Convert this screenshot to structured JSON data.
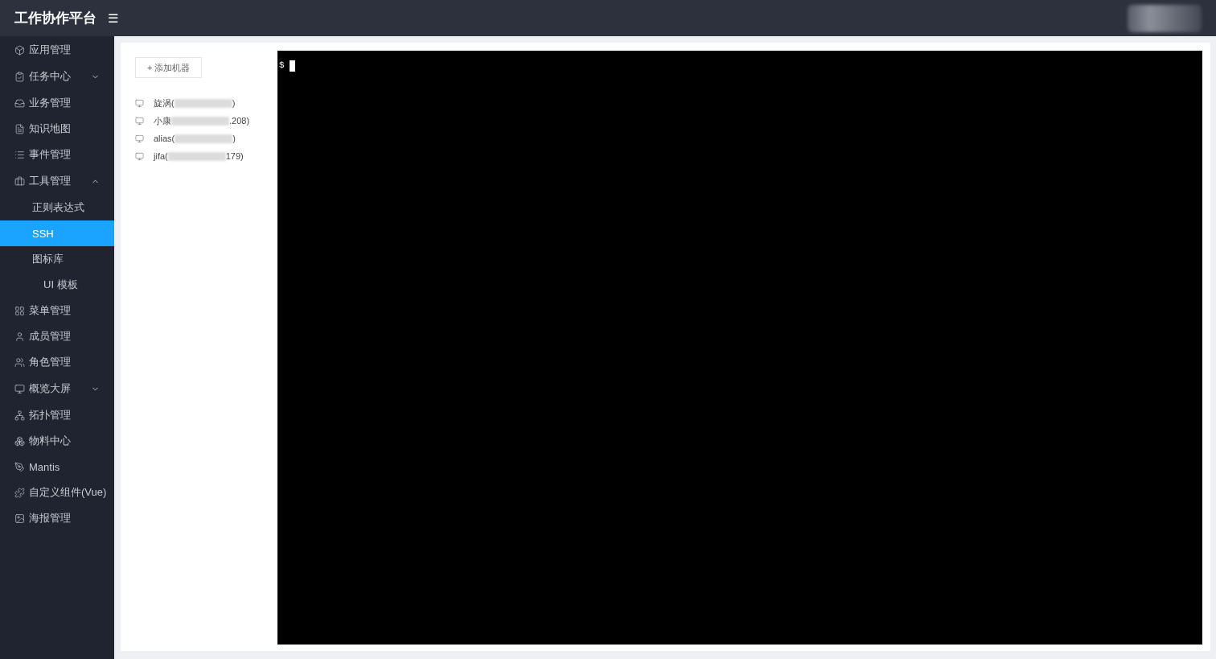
{
  "header": {
    "title": "工作协作平台",
    "menu_icon": "☰"
  },
  "sidebar": {
    "items": [
      {
        "label": "应用管理"
      },
      {
        "label": "任务中心",
        "expanded": false
      },
      {
        "label": "业务管理"
      },
      {
        "label": "知识地图"
      },
      {
        "label": "事件管理"
      },
      {
        "label": "工具管理",
        "expanded": true,
        "children": [
          {
            "label": "正则表达式",
            "selected": false
          },
          {
            "label": "SSH",
            "selected": true
          },
          {
            "label": "图标库",
            "selected": false,
            "children": [
              {
                "label": "UI 模板",
                "selected": false
              }
            ]
          }
        ]
      },
      {
        "label": "菜单管理"
      },
      {
        "label": "成员管理"
      },
      {
        "label": "角色管理"
      },
      {
        "label": "概览大屏",
        "expanded": false
      },
      {
        "label": "拓扑管理"
      },
      {
        "label": "物料中心"
      },
      {
        "label": "Mantis"
      },
      {
        "label": "自定义组件(Vue)"
      },
      {
        "label": "海报管理"
      }
    ]
  },
  "machines": {
    "add_button": "+ 添加机器",
    "items": [
      {
        "prefix": "旋涡(",
        "suffix": ")"
      },
      {
        "prefix": "小康",
        "suffix": ".208)"
      },
      {
        "prefix": "alias(",
        "suffix": ")"
      },
      {
        "prefix": "jifa(",
        "suffix": "179)"
      }
    ]
  },
  "terminal": {
    "prompt": "$"
  }
}
